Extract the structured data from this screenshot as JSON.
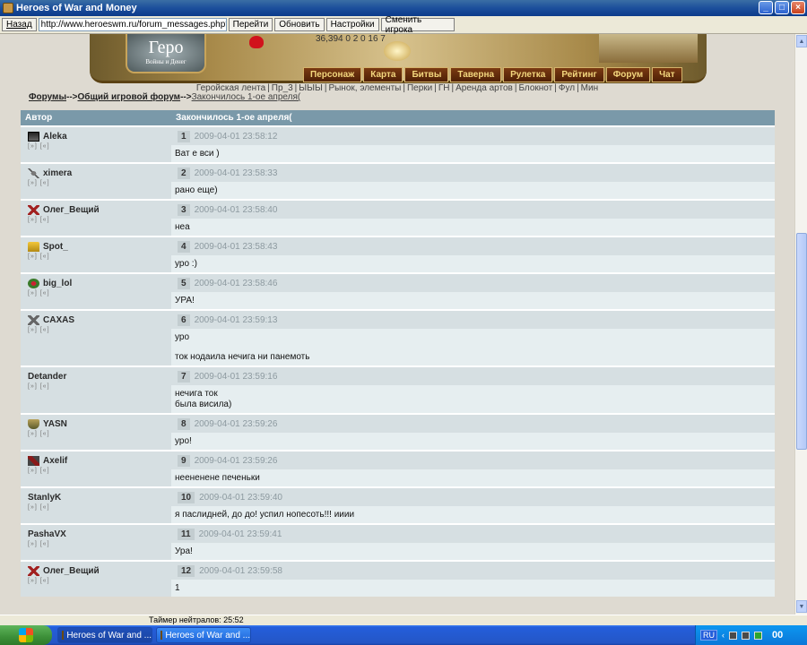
{
  "window": {
    "title": "Heroes of War and Money"
  },
  "toolbar": {
    "back_label": "Назад",
    "url": "http://www.heroeswm.ru/forum_messages.php?tid=2627118p",
    "go_label": "Перейти",
    "refresh_label": "Обновить",
    "settings_label": "Настройки",
    "switch_player_label": "Сменить игрока"
  },
  "banner": {
    "logo_text": "Геро",
    "logo_subtext": "Войны и Денег",
    "resources_text": "36,394   0   2   0   16   7"
  },
  "nav": [
    "Персонаж",
    "Карта",
    "Битвы",
    "Таверна",
    "Рулетка",
    "Рейтинг",
    "Форум",
    "Чат"
  ],
  "sublinks": [
    "Геройская лента",
    "Пр_3",
    "ЫЫЫ",
    "Рынок, элементы",
    "Перки",
    "ГН",
    "Аренда артов",
    "Блокнот",
    "Фул",
    "Мин"
  ],
  "breadcrumb": {
    "forums": "Форумы",
    "arrow1": "-->",
    "general": "Общий игровой форум",
    "arrow2": "-->",
    "topic": "Закончилось 1-ое апреля("
  },
  "table": {
    "col_author": "Автор",
    "col_topic": "Закончилось 1-ое апреля(",
    "mini_links": "[»] [«]",
    "posts": [
      {
        "author": "Aleka",
        "icon": "clan-icon",
        "num": "1",
        "date": "2009-04-01 23:58:12",
        "lines": [
          "Ват е вси )"
        ]
      },
      {
        "author": "ximera",
        "icon": "sword-icon",
        "num": "2",
        "date": "2009-04-01 23:58:33",
        "lines": [
          "рано еще)"
        ]
      },
      {
        "author": "Олег_Вещий",
        "icon": "red-cross-icon",
        "num": "3",
        "date": "2009-04-01 23:58:40",
        "lines": [
          "неа"
        ]
      },
      {
        "author": "Spot_",
        "icon": "crown-icon",
        "num": "4",
        "date": "2009-04-01 23:58:43",
        "lines": [
          "уро :)"
        ]
      },
      {
        "author": "big_lol",
        "icon": "cart-icon",
        "num": "5",
        "date": "2009-04-01 23:58:46",
        "lines": [
          "УРА!"
        ]
      },
      {
        "author": "CAXAS",
        "icon": "crossed-swords-icon",
        "num": "6",
        "date": "2009-04-01 23:59:13",
        "lines": [
          "уро",
          "ток нодаила нечига ни панемоть"
        ]
      },
      {
        "author": "Detander",
        "icon": "",
        "num": "7",
        "date": "2009-04-01 23:59:16",
        "lines": [
          "нечига ток\nбыла висила)"
        ]
      },
      {
        "author": "YASN",
        "icon": "shield-icon",
        "num": "8",
        "date": "2009-04-01 23:59:26",
        "lines": [
          "уро!"
        ]
      },
      {
        "author": "Axelif",
        "icon": "axe-icon",
        "num": "9",
        "date": "2009-04-01 23:59:26",
        "lines": [
          "неененене печеньки"
        ]
      },
      {
        "author": "StanlyK",
        "icon": "",
        "num": "10",
        "date": "2009-04-01 23:59:40",
        "lines": [
          "я паслидней, до до! успил нопесоть!!! ииии"
        ]
      },
      {
        "author": "PashaVX",
        "icon": "",
        "num": "11",
        "date": "2009-04-01 23:59:41",
        "lines": [
          "Ура!"
        ]
      },
      {
        "author": "Олег_Вещий",
        "icon": "red-cross-icon",
        "num": "12",
        "date": "2009-04-01 23:59:58",
        "lines": [
          "1"
        ]
      }
    ]
  },
  "status": {
    "timer_text": "Таймер нейтралов: 25:52"
  },
  "taskbar": {
    "task1": "Heroes of War and ...",
    "task2": "Heroes of War and ...",
    "lang": "RU",
    "clock": "00"
  }
}
